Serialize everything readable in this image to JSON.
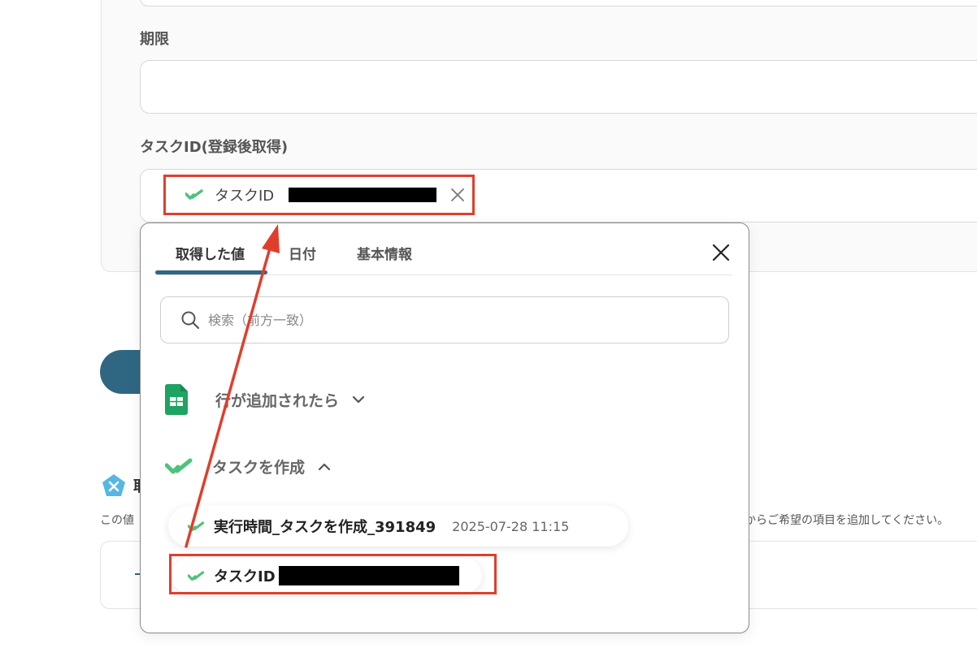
{
  "form": {
    "deadline_label": "期限",
    "task_id_label": "タスクID(登録後取得)",
    "selected_chip": {
      "label": "タスクID",
      "icon": "check-brand-icon"
    }
  },
  "background": {
    "section_title": "取",
    "help_left": "この値",
    "help_right": "からご希望の項目を追加してください。"
  },
  "popup": {
    "tabs": [
      {
        "label": "取得した値",
        "active": true
      },
      {
        "label": "日付",
        "active": false
      },
      {
        "label": "基本情報",
        "active": false
      }
    ],
    "search_placeholder": "検索（前方一致）",
    "groups": [
      {
        "label": "行が追加されたら",
        "icon": "google-sheets-icon",
        "expanded": false
      },
      {
        "label": "タスクを作成",
        "icon": "check-brand-icon",
        "expanded": true
      }
    ],
    "items": [
      {
        "label": "実行時間_タスクを作成_391849",
        "time": "2025-07-28 11:15"
      },
      {
        "label": "タスクID"
      }
    ]
  },
  "colors": {
    "accent": "#2f6782",
    "highlight": "#e03e2d",
    "check_green": "#4cc37a"
  }
}
